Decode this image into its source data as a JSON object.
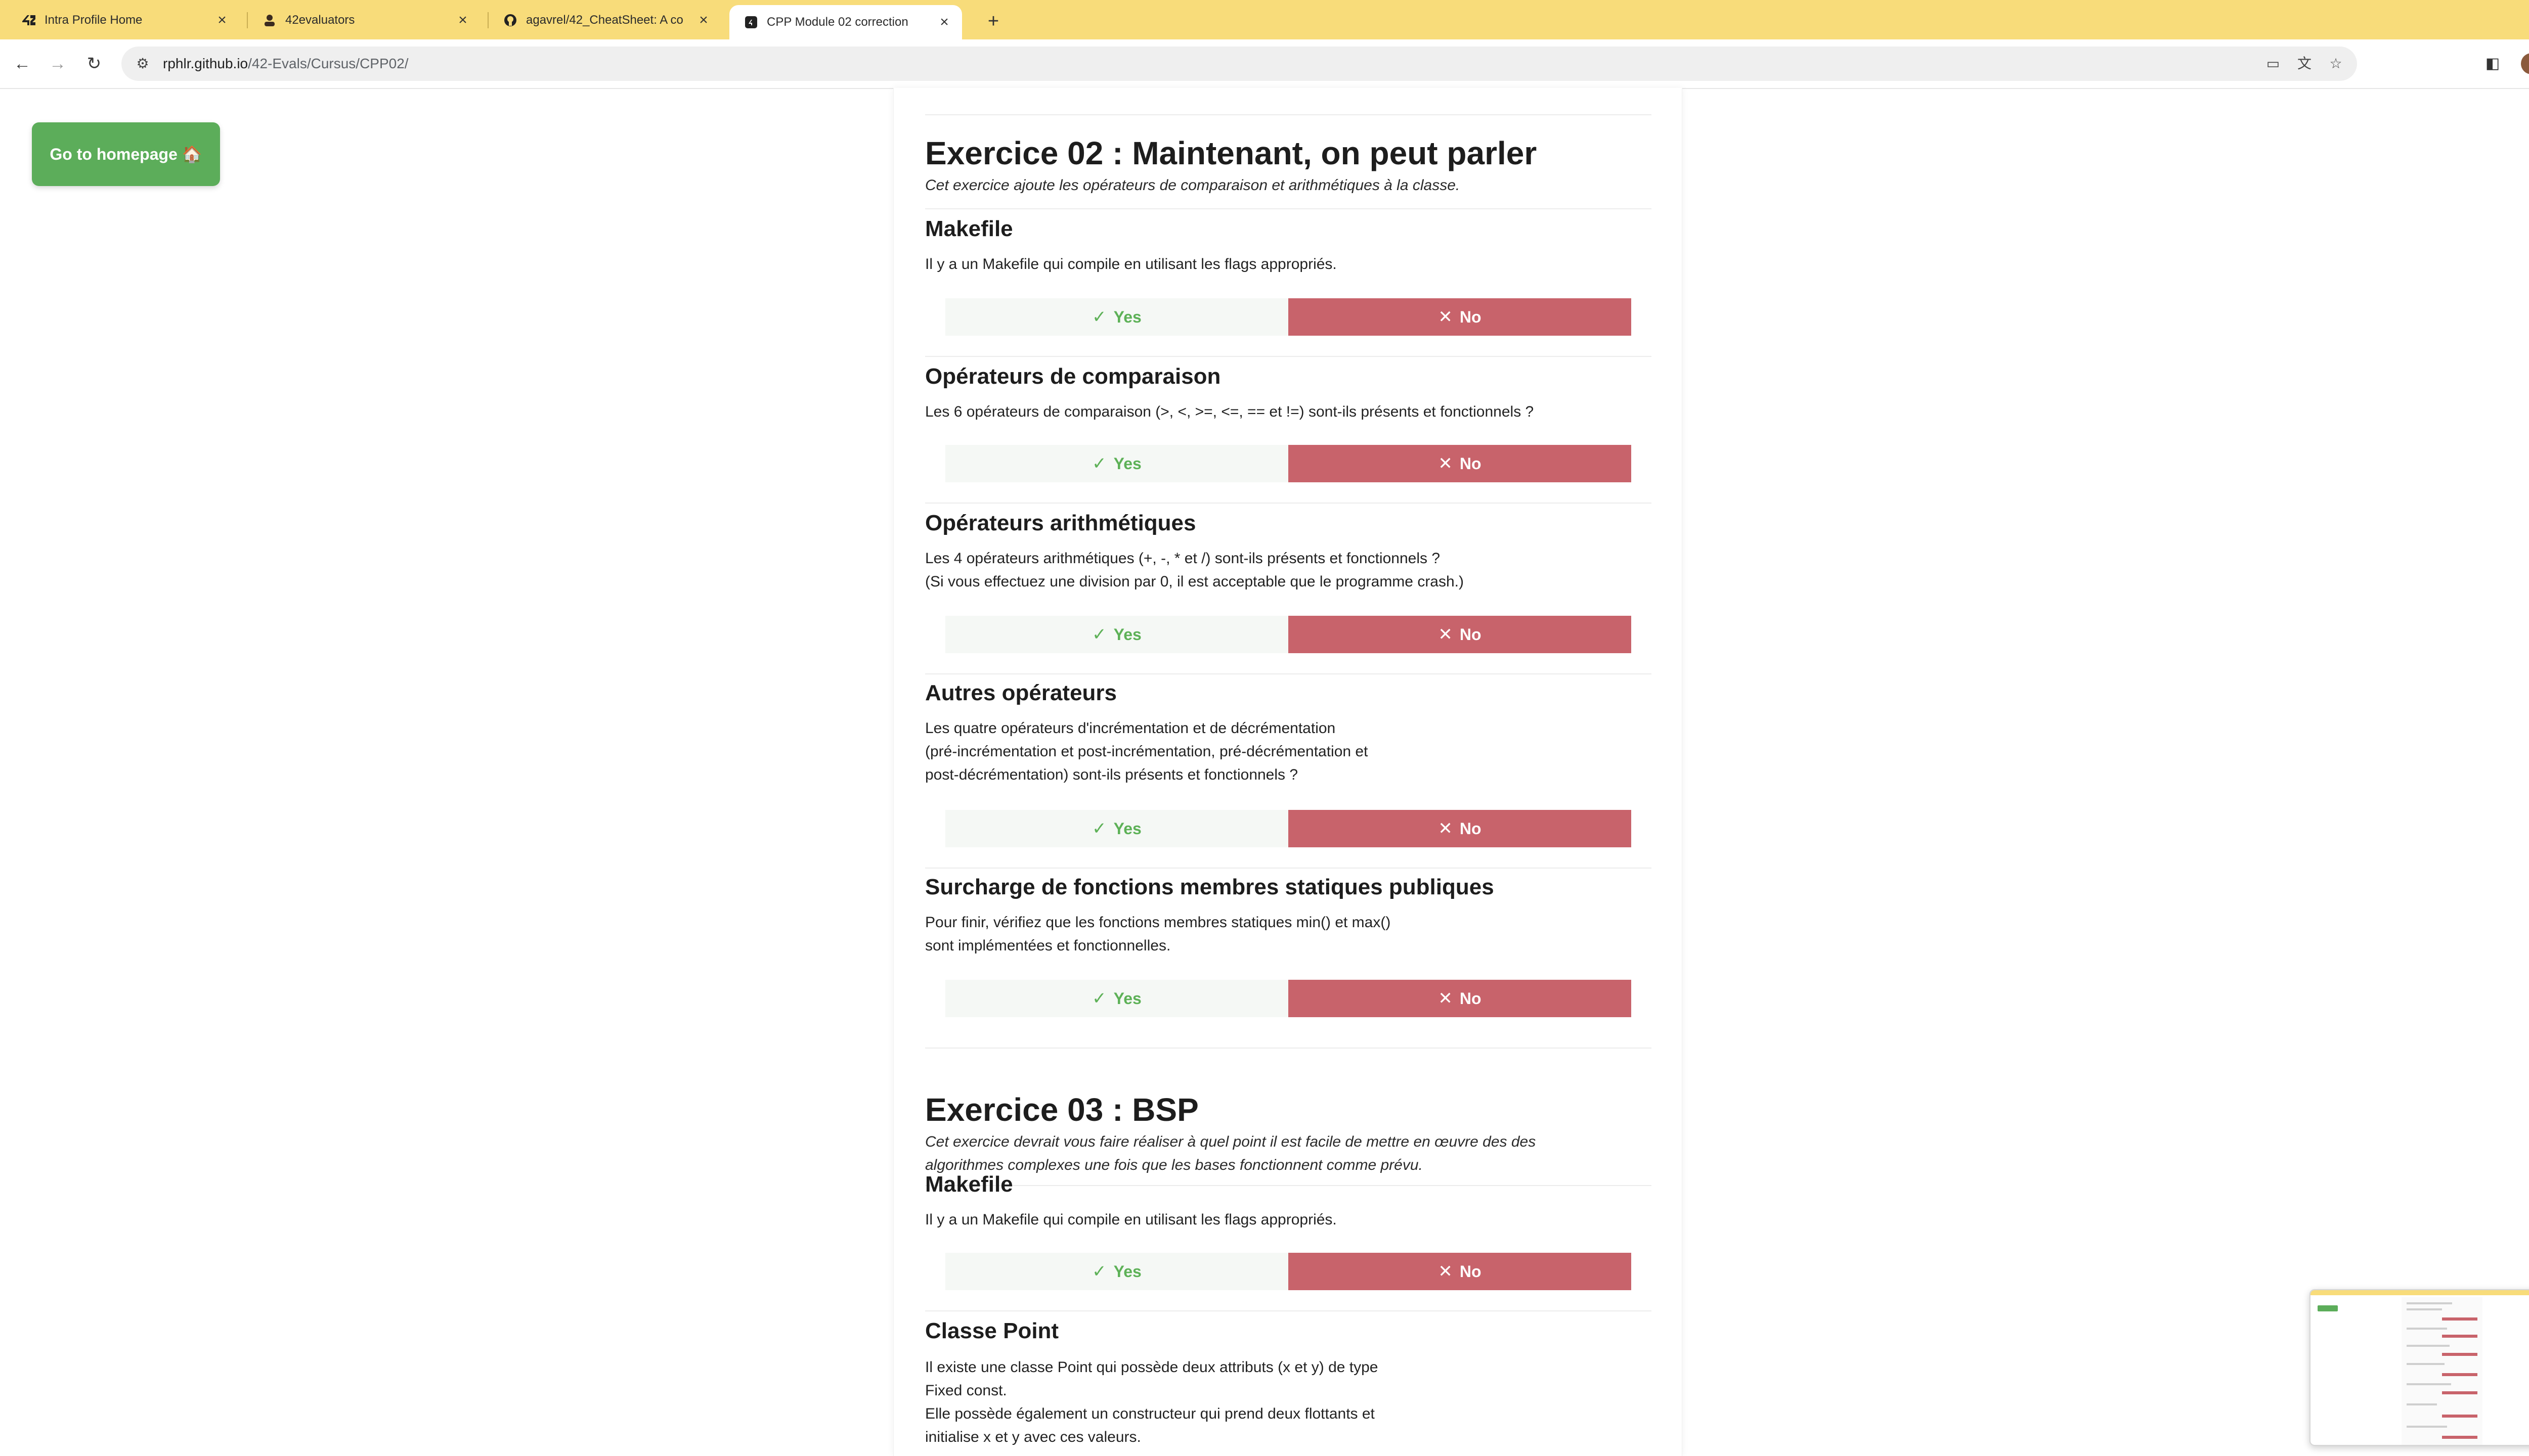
{
  "browser": {
    "tabs": [
      {
        "title": "Intra Profile Home",
        "icon": "42-logo-icon",
        "active": false
      },
      {
        "title": "42evaluators",
        "icon": "evaluator-icon",
        "active": false
      },
      {
        "title": "agavrel/42_CheatSheet: A co",
        "icon": "github-icon",
        "active": false
      },
      {
        "title": "CPP Module 02 correction",
        "icon": "site-icon",
        "active": true
      }
    ],
    "close_glyph": "×",
    "new_tab_glyph": "+",
    "tab_menu_glyph": "⌄",
    "url_host": "rphlr.github.io",
    "url_path": "/42-Evals/Cursus/CPP02/",
    "back_glyph": "←",
    "forward_glyph": "→",
    "reload_glyph": "↻",
    "site_info_glyph": "⚙",
    "omni_icons": [
      "▭",
      "文",
      "☆"
    ],
    "sidebar_glyph": "◧",
    "menu_glyph": "⋮"
  },
  "page": {
    "home_button": "Go to homepage 🏠",
    "yes_label": "Yes",
    "no_label": "No",
    "yes_icon": "✓",
    "no_icon": "✕",
    "exercises": [
      {
        "title": "Exercice 02 : Maintenant, on peut parler",
        "subtitle": "Cet exercice ajoute les opérateurs de comparaison et arithmétiques à la classe.",
        "questions": [
          {
            "title": "Makefile",
            "lines": [
              "Il y a un Makefile qui compile en utilisant les flags appropriés."
            ]
          },
          {
            "title": "Opérateurs de comparaison",
            "lines": [
              "Les 6 opérateurs de comparaison (>, <, >=, <=, == et !=) sont-ils présents et fonctionnels ?"
            ]
          },
          {
            "title": "Opérateurs arithmétiques",
            "lines": [
              "Les 4 opérateurs arithmétiques (+, -, * et /) sont-ils présents et fonctionnels ?",
              "(Si vous effectuez une division par 0, il est acceptable que le programme crash.)"
            ]
          },
          {
            "title": "Autres opérateurs",
            "lines": [
              "Les quatre opérateurs d'incrémentation et de décrémentation",
              "(pré-incrémentation et post-incrémentation, pré-décrémentation et",
              "post-décrémentation) sont-ils présents et fonctionnels ?"
            ]
          },
          {
            "title": "Surcharge de fonctions membres statiques publiques",
            "lines": [
              "Pour finir, vérifiez que les fonctions membres statiques min() et max()",
              "sont implémentées et fonctionnelles."
            ]
          }
        ]
      },
      {
        "title": "Exercice 03 : BSP",
        "subtitle_lines": [
          "Cet exercice devrait vous faire réaliser à quel point il est facile de mettre en œuvre des des",
          "algorithmes complexes une fois que les bases fonctionnent comme prévu."
        ],
        "questions": [
          {
            "title": "Makefile",
            "lines": [
              "Il y a un Makefile qui compile en utilisant les flags appropriés."
            ]
          },
          {
            "title": "Classe Point",
            "lines": [
              "Il existe une classe Point qui possède deux attributs (x et y) de type",
              "Fixed const.",
              "Elle possède également un constructeur qui prend deux flottants et",
              "initialise x et y avec ces valeurs."
            ]
          }
        ]
      }
    ]
  }
}
